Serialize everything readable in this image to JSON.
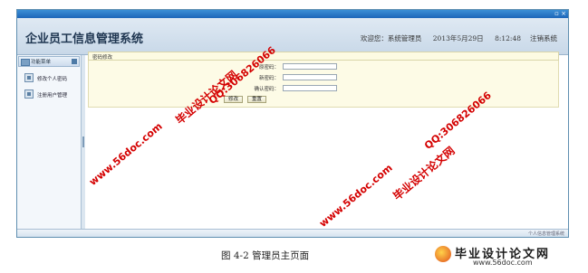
{
  "app": {
    "title": "企业员工信息管理系统",
    "welcome": "欢迎您：系统管理员",
    "date": "2013年5月29日",
    "time": "8:12:48",
    "logout_label": "注销系统"
  },
  "sidebar": {
    "header": "功能菜单",
    "items": [
      {
        "label": "修改个人密码"
      },
      {
        "label": "注册用户管理"
      }
    ]
  },
  "panel": {
    "title": "密码修改",
    "fields": [
      {
        "label": "原密码：",
        "value": ""
      },
      {
        "label": "新密码：",
        "value": ""
      },
      {
        "label": "确认密码：",
        "value": ""
      }
    ],
    "submit_label": "修改",
    "reset_label": "重置"
  },
  "status": {
    "text": "个人信息管理系统"
  },
  "caption": "图 4-2 管理员主页面",
  "watermarks": {
    "site": "www.56doc.com",
    "qq": "QQ:306826066",
    "name": "毕业设计论文网",
    "logo_name": "毕业设计论文网",
    "logo_url": "www.56doc.com"
  },
  "colors": {
    "watermark": "#d40000",
    "header_bg": "#c8d8e8",
    "panel_bg": "#fdfbe6"
  }
}
